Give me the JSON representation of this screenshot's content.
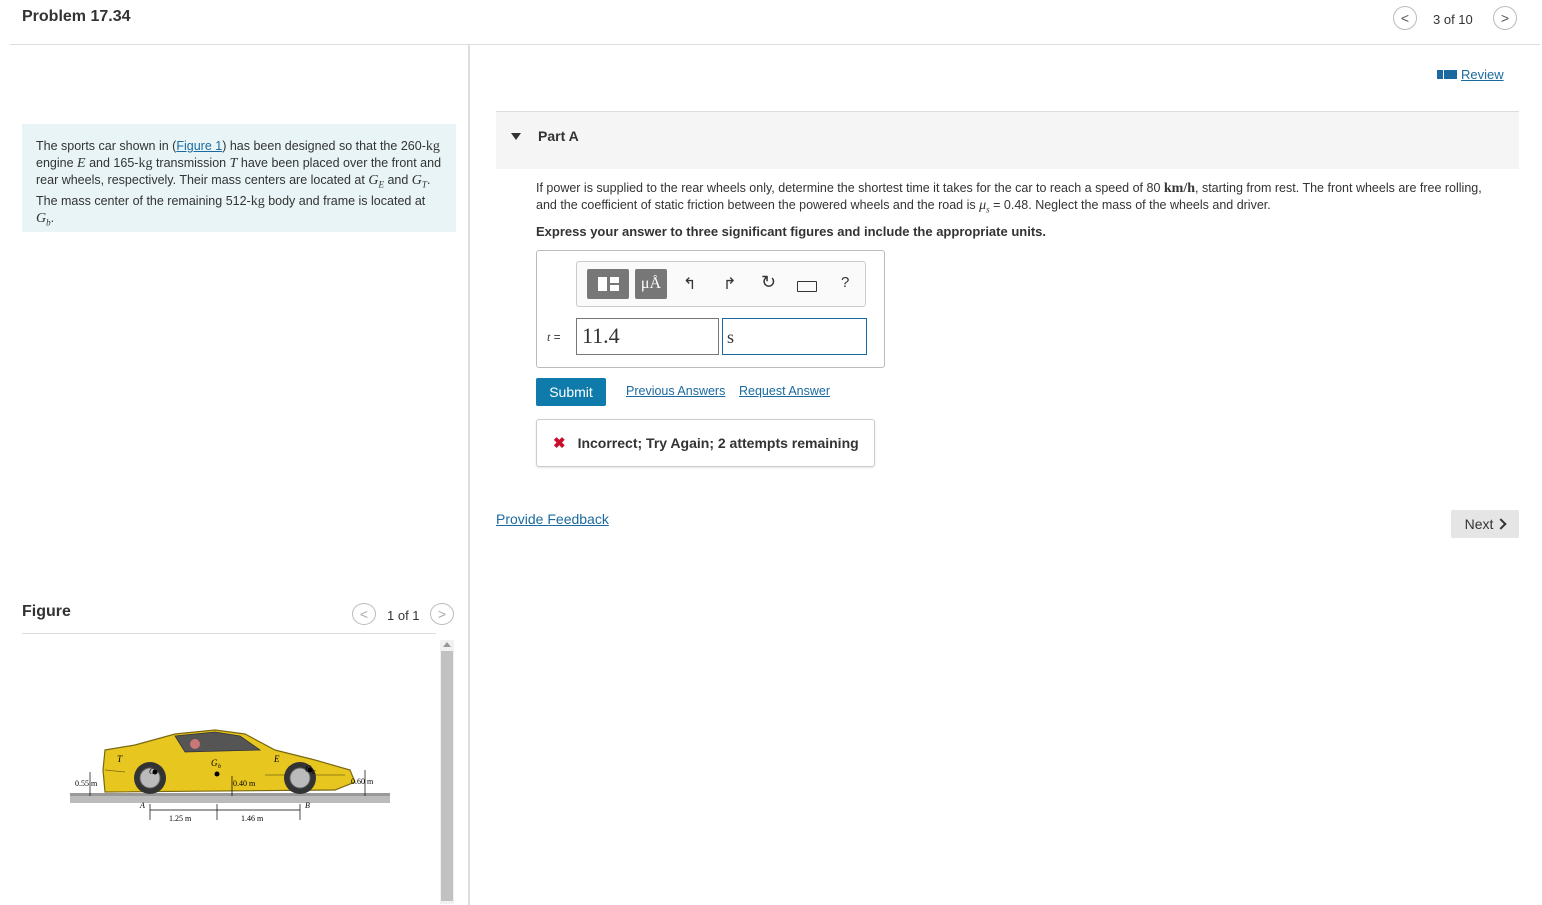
{
  "header": {
    "title": "Problem 17.34",
    "page_indicator": "3 of 10",
    "prev_glyph": "<",
    "next_glyph": ">"
  },
  "review": {
    "label": "Review"
  },
  "problem": {
    "t1": "The sports car shown in (",
    "figure_link": "Figure 1",
    "t2": ") has been designed so that the",
    "m_260": "260",
    "kg": "kg",
    "t3": "engine",
    "E": "E",
    "t4": "and",
    "m_165": "165",
    "t5": "transmission",
    "T": "T",
    "t6": "have been placed over the front and rear wheels, respectively. Their mass centers are located at",
    "GE": "G",
    "GE_sub": "E",
    "t7": "and",
    "GT": "G",
    "GT_sub": "T",
    "t8": ". The mass center of the remaining",
    "m_512": "512",
    "t9": "body and frame is located at",
    "Gb": "G",
    "Gb_sub": "b",
    "t10": "."
  },
  "figure": {
    "title": "Figure",
    "page_indicator": "1 of 1",
    "labels": {
      "T": "T",
      "Gt": "G",
      "Gb": "G",
      "b_sub": "b",
      "E": "E",
      "Ge": "G",
      "e_sub": "E",
      "A": "A",
      "B": "B",
      "d055": "0.55 m",
      "d040": "0.40 m",
      "d060": "0.60 m",
      "d125": "1.25 m",
      "d146": "1.46 m"
    }
  },
  "part": {
    "label": "Part A",
    "q1": "If power is supplied to the rear wheels only, determine the shortest time it takes for the car to reach a speed of 80",
    "kmh": "km/h",
    "q2": ", starting from rest. The front wheels are free rolling, and the coefficient of static friction between the powered wheels and the road is",
    "mu": "μ",
    "mu_sub": "s",
    "q3": "= 0.48. Neglect the mass of the wheels and driver.",
    "express": "Express your answer to three significant figures and include the appropriate units."
  },
  "answer": {
    "var_label": "t",
    "equals": " = ",
    "value": "11.4",
    "unit": "s",
    "toolbar": {
      "template_icon": "template-icon",
      "units_label": "μÅ",
      "undo_icon": "undo-icon",
      "redo_icon": "redo-icon",
      "reset_icon": "reset-icon",
      "keyboard_icon": "keyboard-icon",
      "help_label": "?"
    }
  },
  "actions": {
    "submit": "Submit",
    "previous_answers": "Previous Answers",
    "request_answer": "Request Answer"
  },
  "feedback": {
    "icon": "✖",
    "message": "Incorrect; Try Again; 2 attempts remaining"
  },
  "footer": {
    "provide_feedback": "Provide Feedback",
    "next": "Next"
  },
  "colors": {
    "link": "#1a6aa0",
    "submit_bg": "#0f7bab",
    "error": "#c8102e",
    "problem_bg": "#e8f4f5"
  }
}
